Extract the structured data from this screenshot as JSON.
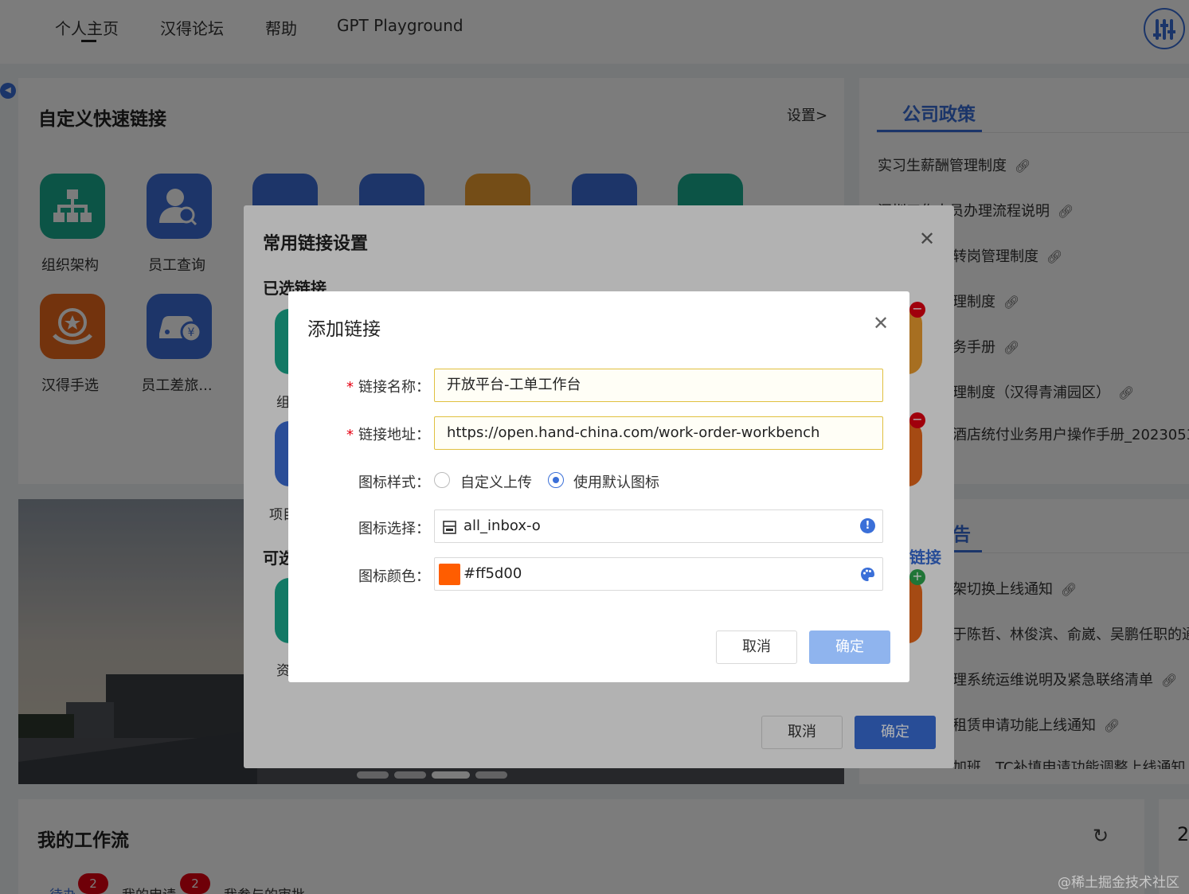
{
  "nav": {
    "items": [
      "个人主页",
      "汉得论坛",
      "帮助",
      "GPT Playground"
    ]
  },
  "quick_links": {
    "title": "自定义快速链接",
    "settings_label": "设置>",
    "items": [
      {
        "label": "组织架构",
        "color": "#1aae91",
        "icon": "org-chart-icon"
      },
      {
        "label": "员工查询",
        "color": "#3d6fd8",
        "icon": "user-search-icon"
      },
      {
        "label": "汉得手选",
        "color": "#ed6a1c",
        "icon": "star-hand-icon"
      },
      {
        "label": "员工差旅...",
        "color": "#3d6fd8",
        "icon": "car-money-icon"
      }
    ],
    "extra_tile_colors": [
      "#3d6fd8",
      "#3d6fd8",
      "#f0a030",
      "#3d6fd8",
      "#1aae91"
    ]
  },
  "policy": {
    "tab": "公司政策",
    "items": [
      "实习生薪酬管理制度",
      "深圳工作人员办理流程说明",
      "转岗管理制度",
      "理制度",
      "务手册",
      "理制度（汉得青浦园区）",
      "酒店统付业务用户操作手册_20230531"
    ]
  },
  "notice": {
    "tab": "告",
    "items": [
      "架切换上线通知",
      "于陈哲、林俊滨、俞崴、吴鹏任职的通",
      "理系统运维说明及紧急联络清单",
      "租赁申请功能上线通知",
      "加班、TC补填申请功能调整上线通知"
    ]
  },
  "workflow": {
    "title": "我的工作流",
    "side_number": "2",
    "tabs": [
      {
        "label": "待办",
        "badge": "2"
      },
      {
        "label": "我的申请",
        "badge": "2"
      },
      {
        "label": "我参与的审批",
        "badge": ""
      }
    ]
  },
  "modal_common": {
    "title": "常用链接设置",
    "selected_label": "已选链接",
    "available_label": "可选链接",
    "side_tab_label": "链接",
    "tile_labels": [
      "组",
      "项目",
      "资"
    ],
    "cancel": "取消",
    "ok": "确定"
  },
  "modal_add": {
    "title": "添加链接",
    "name_label": "链接名称",
    "name_value": "开放平台-工单工作台",
    "url_label": "链接地址",
    "url_value": "https://open.hand-china.com/work-order-workbench",
    "icon_style_label": "图标样式",
    "radio_custom": "自定义上传",
    "radio_default": "使用默认图标",
    "icon_select_label": "图标选择",
    "icon_select_value": "all_inbox-o",
    "icon_color_label": "图标颜色",
    "icon_color_value": "#ff5d00",
    "cancel": "取消",
    "ok": "确定"
  },
  "watermark": "@稀土掘金技术社区",
  "colors": {
    "primary": "#3a6fd8",
    "primary_disabled": "#8fb4ee",
    "danger": "#e60012",
    "success": "#2fa84f",
    "selected_icon_color": "#ff5d00"
  }
}
